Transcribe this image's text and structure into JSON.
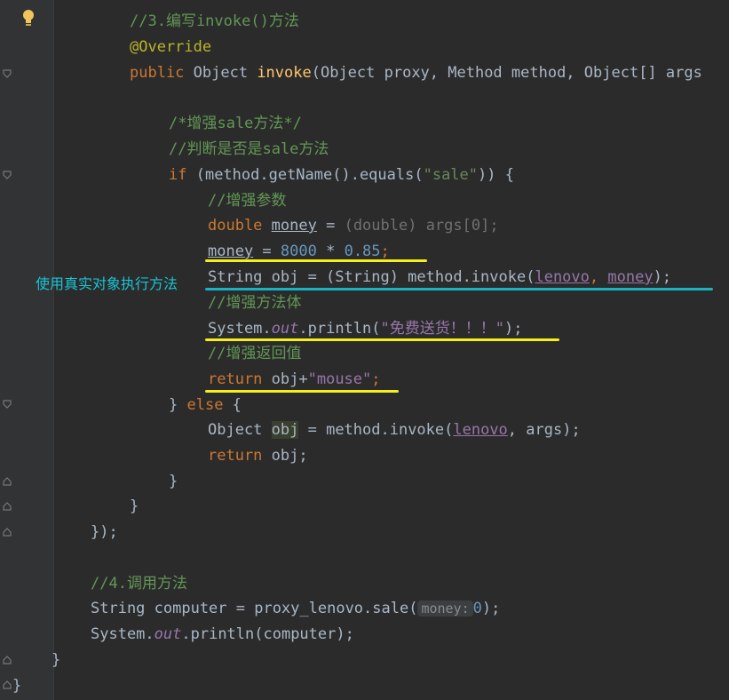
{
  "code": {
    "l1_cmt": "//3.编写invoke()方法",
    "l2_ann": "@Override",
    "l3_kw": "public",
    "l3_a": " Object ",
    "l3_fn": "invoke",
    "l3_b": "(Object proxy, Method method, Object[] args",
    "l5_cmt": "/*增强sale方法*/",
    "l6_cmt": "//判断是否是sale方法",
    "l7_kw": "if",
    "l7_a": " (method.getName().equals(",
    "l7_str": "\"sale\"",
    "l7_b": ")) {",
    "l8_cmt": "//增强参数",
    "l9_kw": "double",
    "l9_var": "money",
    "l9_eq": " = ",
    "l9_cast": "(double) args[0];",
    "l10_var": "money",
    "l10_eq": " = ",
    "l10_n1": "8000",
    "l10_op": " * ",
    "l10_n2": "0.85",
    "l10_semi": ";",
    "l11_a": "String obj = (String) method.invoke(",
    "l11_p1": "lenovo",
    "l11_sep": ", ",
    "l11_p2": "money",
    "l11_b": ");",
    "l12_cmt": "//增强方法体",
    "l13_a": "System.",
    "l13_f": "out",
    "l13_b": ".println(",
    "l13_str": "\"免费送货！！！\"",
    "l13_c": ");",
    "l14_cmt": "//增强返回值",
    "l15_kw": "return",
    "l15_a": " obj+",
    "l15_str": "\"mouse\"",
    "l15_semi": ";",
    "l16_a": "} ",
    "l16_kw": "else",
    "l16_b": " {",
    "l17_a": "Object ",
    "l17_var": "obj",
    "l17_b": " = method.invoke(",
    "l17_p": "lenovo",
    "l17_c": ", args);",
    "l18_kw": "return",
    "l18_a": " obj;",
    "l19": "}",
    "l20": "}",
    "l21": "});",
    "l23_cmt": "//4.调用方法",
    "l24_a": "String computer = proxy_lenovo.sale(",
    "l24_hint": "money:",
    "l24_num": "0",
    "l24_b": ");",
    "l25_a": "System.",
    "l25_f": "out",
    "l25_b": ".println(computer);",
    "l26": "}",
    "l27": "}"
  },
  "annotation": {
    "label": "使用真实对象执行方法",
    "underline_color": "#f5f018",
    "annotation_color": "#18c6d6"
  },
  "icons": [
    "intention-bulb-icon",
    "fold-marker-icon"
  ]
}
